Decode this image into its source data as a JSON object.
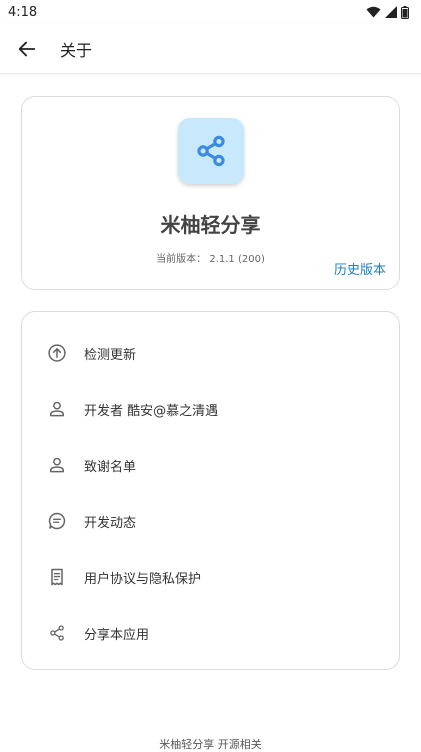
{
  "status_bar": {
    "time": "4:18"
  },
  "app_bar": {
    "title": "关于"
  },
  "about_card": {
    "app_name": "米柚轻分享",
    "version_label": "当前版本：",
    "version_value": "2.1.1 (200)",
    "history_link": "历史版本",
    "icon_bg_color": "#c8e9fb",
    "icon_fg_color": "#3d8be0"
  },
  "menu": {
    "items": [
      {
        "label": "检测更新",
        "icon": "arrow-up-circle-icon"
      },
      {
        "label": "开发者 酷安@慕之清遇",
        "icon": "person-icon"
      },
      {
        "label": "致谢名单",
        "icon": "person-icon"
      },
      {
        "label": "开发动态",
        "icon": "chat-lines-icon"
      },
      {
        "label": "用户协议与隐私保护",
        "icon": "receipt-icon"
      },
      {
        "label": "分享本应用",
        "icon": "share-icon"
      }
    ]
  },
  "footer": {
    "text": "米柚轻分享 开源相关"
  },
  "colors": {
    "link": "#1e7fc0",
    "icon_gray": "#666666"
  }
}
